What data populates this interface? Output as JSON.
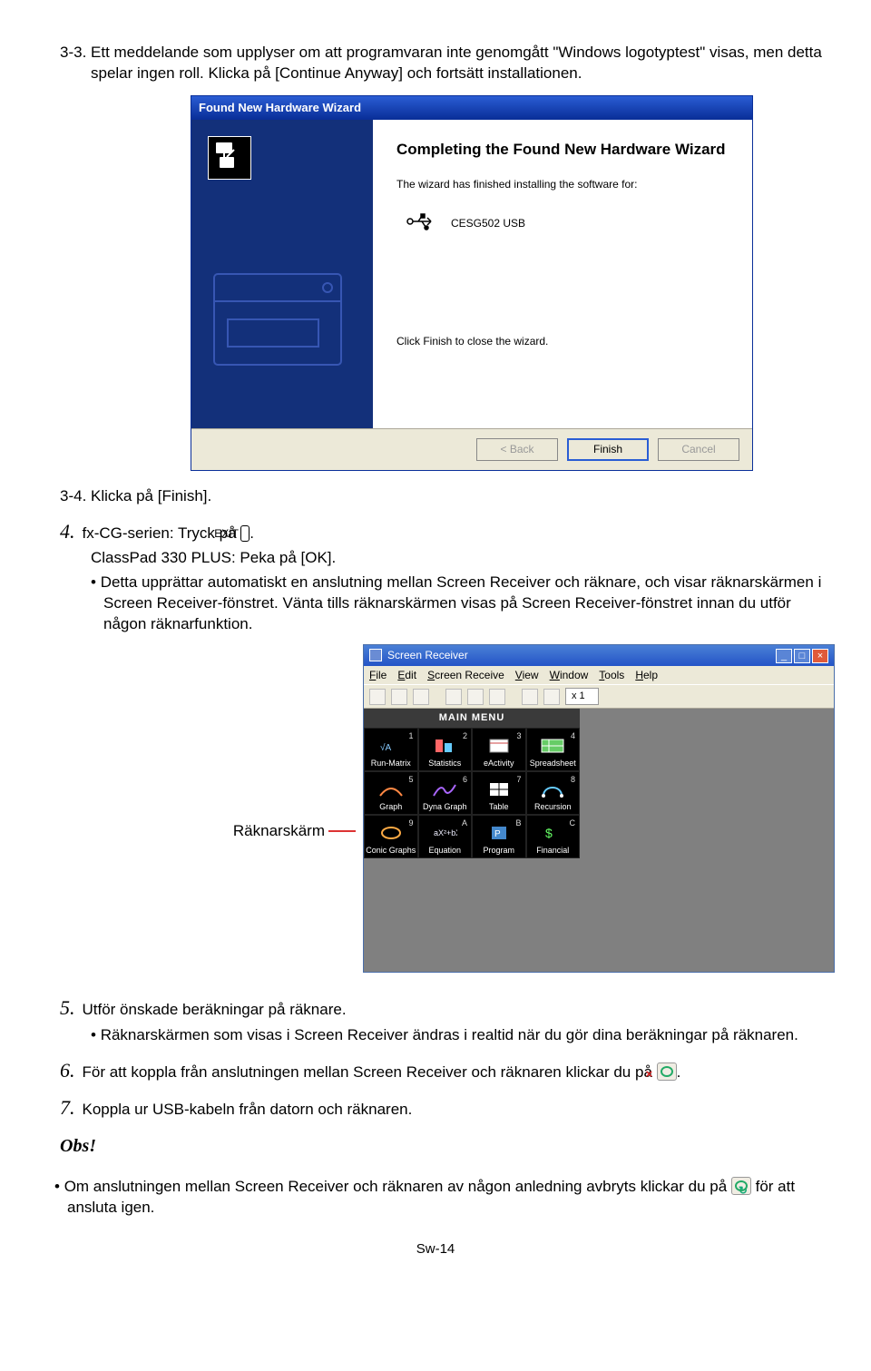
{
  "step_3_3": "3-3. Ett meddelande som upplyser om att programvaran inte genomgått \"Windows logotyptest\" visas, men detta spelar ingen roll. Klicka på [Continue Anyway] och fortsätt installationen.",
  "wizard": {
    "title": "Found New Hardware Wizard",
    "heading": "Completing the Found New Hardware Wizard",
    "text": "The wizard has finished installing the software for:",
    "device": "CESG502 USB",
    "finish_text": "Click Finish to close the wizard.",
    "btn_back": "< Back",
    "btn_finish": "Finish",
    "btn_cancel": "Cancel"
  },
  "step_3_4": "3-4. Klicka på [Finish].",
  "step_4a_pre": "fx-CG-serien: Tryck på ",
  "step_4a_key": "EXIT",
  "step_4a_post": ".",
  "step_4b": "ClassPad 330 PLUS: Peka på [OK].",
  "bullet_4": "Detta upprättar automatiskt en anslutning mellan Screen Receiver och räknare, och visar räknarskärmen i Screen Receiver-fönstret. Vänta tills räknarskärmen visas på Screen Receiver-fönstret innan du utför någon räknarfunktion.",
  "sr_label": "Räknarskärm",
  "sr": {
    "title": "Screen Receiver",
    "menu": [
      "File",
      "Edit",
      "Screen Receive",
      "View",
      "Window",
      "Tools",
      "Help"
    ],
    "zoom": "x 1",
    "main_menu": "MAIN MENU",
    "apps": [
      {
        "n": "1",
        "label": "Run-Matrix"
      },
      {
        "n": "2",
        "label": "Statistics"
      },
      {
        "n": "3",
        "label": "eActivity"
      },
      {
        "n": "4",
        "label": "Spreadsheet"
      },
      {
        "n": "5",
        "label": "Graph"
      },
      {
        "n": "6",
        "label": "Dyna Graph"
      },
      {
        "n": "7",
        "label": "Table"
      },
      {
        "n": "8",
        "label": "Recursion"
      },
      {
        "n": "9",
        "label": "Conic Graphs"
      },
      {
        "n": "A",
        "label": "Equation"
      },
      {
        "n": "B",
        "label": "Program"
      },
      {
        "n": "C",
        "label": "Financial"
      }
    ]
  },
  "step_5": "Utför önskade beräkningar på räknare.",
  "bullet_5": "Räknarskärmen som visas i Screen Receiver ändras i realtid när du gör dina beräkningar på räknaren.",
  "step_6_pre": "För att koppla från anslutningen mellan Screen Receiver och räknaren klickar du på ",
  "step_6_post": ".",
  "step_7": "Koppla ur USB-kabeln från datorn och räknaren.",
  "obs_title": "Obs!",
  "obs_pre": "Om anslutningen mellan Screen Receiver och räknaren av någon anledning avbryts klickar du på ",
  "obs_post": " för att ansluta igen.",
  "footer": "Sw-14",
  "big4": "4.",
  "big5": "5.",
  "big6": "6.",
  "big7": "7."
}
